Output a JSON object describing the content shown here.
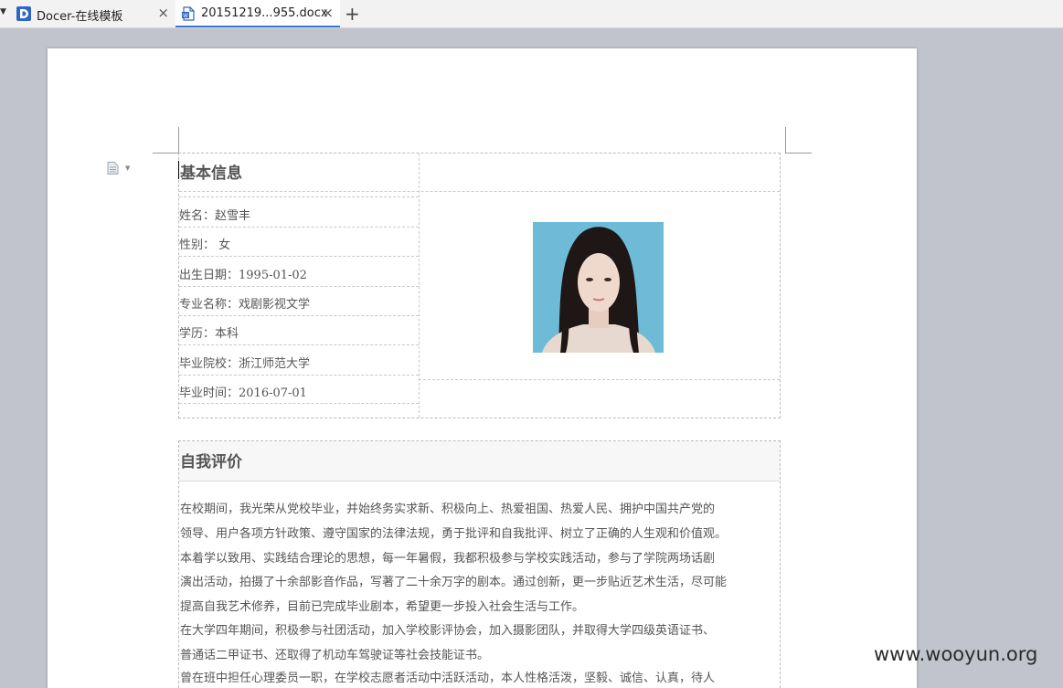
{
  "tabs": [
    {
      "label": "Docer-在线模板",
      "icon": "docer-logo-icon"
    },
    {
      "label": "20151219...955.docx",
      "icon": "word-doc-icon",
      "active": true
    }
  ],
  "accent_color": "#3a78d8",
  "basic_info": {
    "heading": "基本信息",
    "fields": [
      "姓名：赵雪丰",
      "性别：  女",
      "出生日期：1995-01-02",
      "专业名称：戏剧影视文学",
      "学历：本科",
      "毕业院校：浙江师范大学",
      "毕业时间：2016-07-01"
    ]
  },
  "self_eval": {
    "heading": "自我评价",
    "lines": [
      "在校期间，我光荣从党校毕业，并始终务实求新、积极向上、热爱祖国、热爱人民、拥护中国共产党的",
      "领导、用户各项方针政策、遵守国家的法律法规，勇于批评和自我批评、树立了正确的人生观和价值观。",
      "本着学以致用、实践结合理论的思想，每一年暑假，我都积极参与学校实践活动，参与了学院两场话剧",
      "演出活动，拍摄了十余部影音作品，写著了二十余万字的剧本。通过创新，更一步贴近艺术生活，尽可能",
      "提高自我艺术修养，目前已完成毕业剧本，希望更一步投入社会生活与工作。",
      "在大学四年期间，积极参与社团活动，加入学校影评协会，加入摄影团队，并取得大学四级英语证书、",
      "普通话二甲证书、还取得了机动车驾驶证等社会技能证书。",
      "曾在班中担任心理委员一职，在学校志愿者活动中活跃活动，本人性格活泼，坚毅、诚信、认真，待人"
    ]
  },
  "watermark": "www.wooyun.org"
}
